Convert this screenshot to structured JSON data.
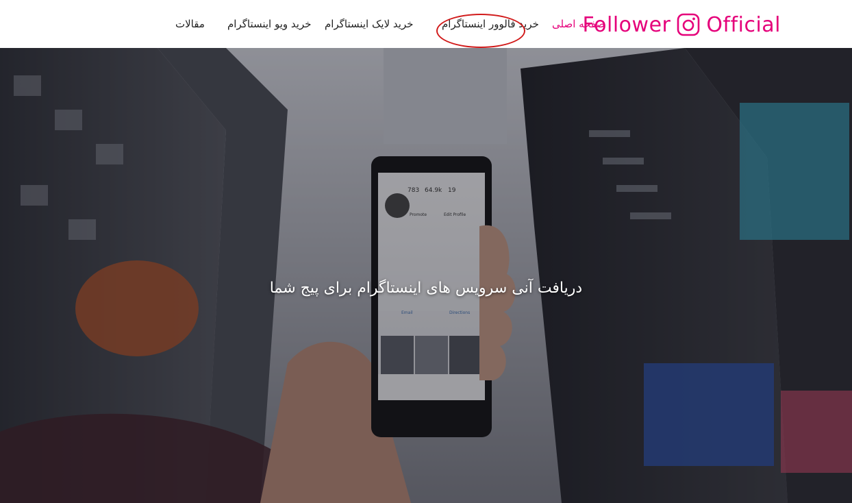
{
  "header": {
    "logo": {
      "word_left": "Follower",
      "word_right": "Official",
      "icon": "instagram-icon",
      "color": "#e5007a"
    },
    "nav": [
      {
        "label": "صفحه اصلی",
        "active": true
      },
      {
        "label": "خرید فالوور اینستاگرام",
        "active": false
      },
      {
        "label": "خرید لایک اینستاگرام",
        "active": false
      },
      {
        "label": "خرید ویو اینستاگرام",
        "active": false
      },
      {
        "label": "مقالات",
        "active": false
      }
    ],
    "highlight_color": "#d11a1a"
  },
  "hero": {
    "title": "دریافت آنی سرویس های اینستاگرام برای پیج شما",
    "image": "hand-holding-phone-instagram-profile-city-background",
    "phone_screen": {
      "posts": "783",
      "followers": "64.9k",
      "following": "19",
      "promote": "Promote",
      "edit_profile": "Edit Profile",
      "tab_email": "Email",
      "tab_directions": "Directions"
    }
  }
}
